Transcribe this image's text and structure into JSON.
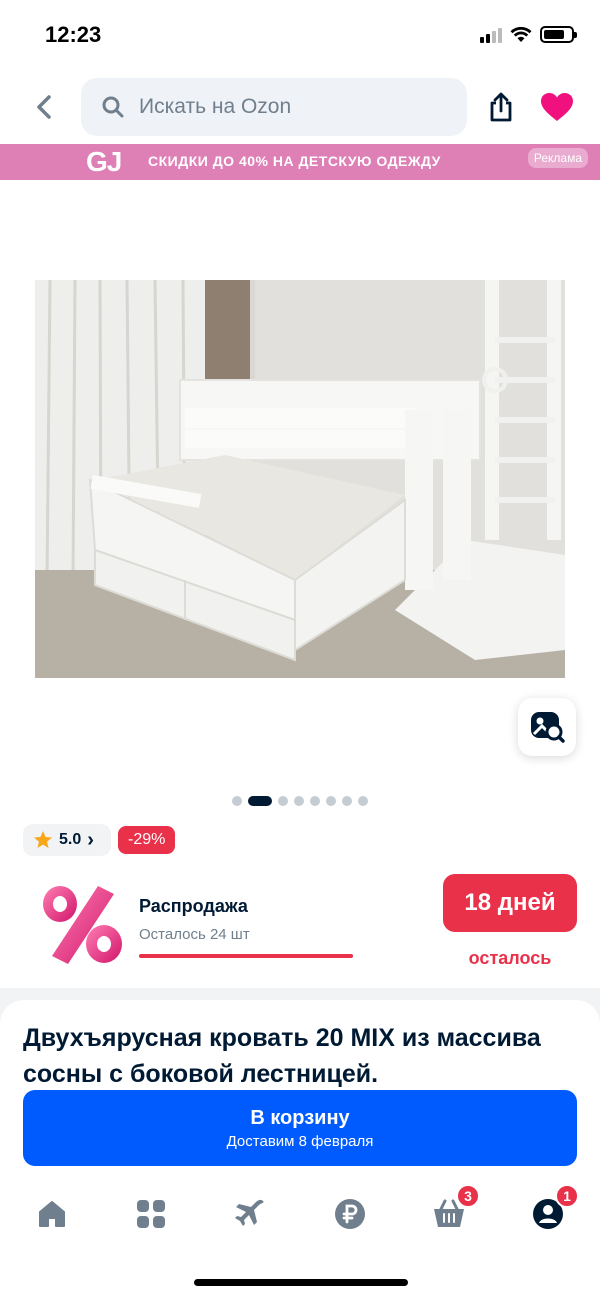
{
  "status_bar": {
    "time": "12:23"
  },
  "header": {
    "search_placeholder": "Искать на Ozon"
  },
  "promo": {
    "logo": "GJ",
    "text": "СКИДКИ ДО 40% НА ДЕТСКУЮ ОДЕЖДУ",
    "ad_label": "Реклама"
  },
  "gallery": {
    "total_images": 8,
    "active_index": 1
  },
  "rating": {
    "value": "5.0",
    "arrow": "›"
  },
  "discount": {
    "label": "-29%"
  },
  "sale": {
    "title": "Распродажа",
    "stock_left": "Осталось 24 шт",
    "days_button": "18 дней",
    "days_left_label": "осталось",
    "stock_bar_fraction": 1.0
  },
  "product": {
    "title": "Двухъярусная кровать 20 MIX из массива сосны с боковой лестницей."
  },
  "cart_button": {
    "label": "В корзину",
    "delivery": "Доставим 8 февраля"
  },
  "tabbar": {
    "cart_badge": "3",
    "profile_badge": "1"
  },
  "colors": {
    "accent_blue": "#005bff",
    "sale_red": "#e9314a",
    "promo_pink": "#de7fb6",
    "text_dark": "#001a34"
  }
}
